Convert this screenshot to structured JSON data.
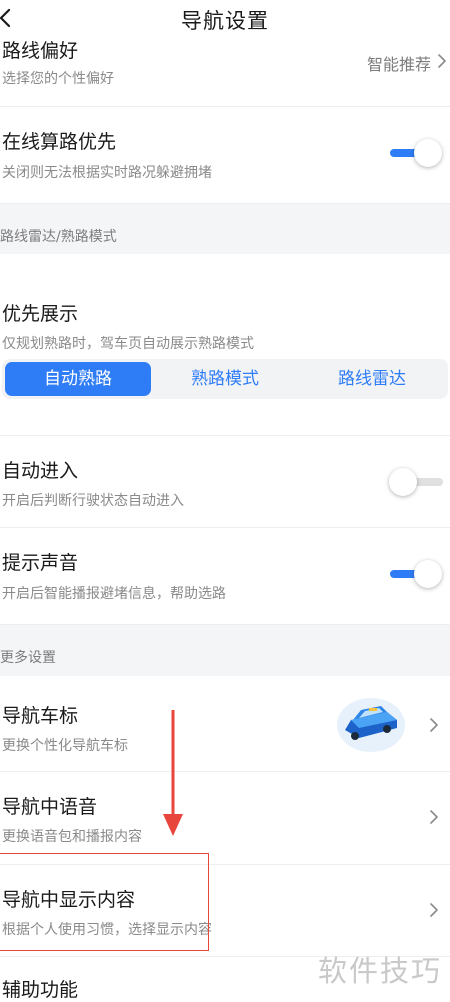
{
  "header": {
    "title": "导航设置"
  },
  "rows": {
    "route_pref": {
      "title": "路线偏好",
      "sub": "选择您的个性偏好",
      "value": "智能推荐"
    },
    "online_calc": {
      "title": "在线算路优先",
      "sub": "关闭则无法根据实时路况躲避拥堵",
      "toggle": "on"
    },
    "priority_display": {
      "title": "优先展示",
      "sub": "仅规划熟路时，驾车页自动展示熟路模式"
    },
    "auto_enter": {
      "title": "自动进入",
      "sub": "开启后判断行驶状态自动进入",
      "toggle": "off"
    },
    "voice_prompt": {
      "title": "提示声音",
      "sub": "开启后智能播报避堵信息，帮助选路",
      "toggle": "on"
    },
    "car_icon": {
      "title": "导航车标",
      "sub": "更换个性化导航车标"
    },
    "nav_voice": {
      "title": "导航中语音",
      "sub": "更换语音包和播报内容"
    },
    "nav_display": {
      "title": "导航中显示内容",
      "sub": "根据个人使用习惯，选择显示内容"
    },
    "assist": {
      "title": "辅助功能"
    }
  },
  "sections": {
    "radar": "路线雷达/熟路模式",
    "more": "更多设置"
  },
  "segmented": {
    "items": [
      "自动熟路",
      "熟路模式",
      "路线雷达"
    ],
    "selected": "自动熟路"
  },
  "colors": {
    "accent": "#2f7df6",
    "annotation_red": "#e8453c",
    "section_bg": "#f4f5f7"
  },
  "watermark": "软件技巧"
}
